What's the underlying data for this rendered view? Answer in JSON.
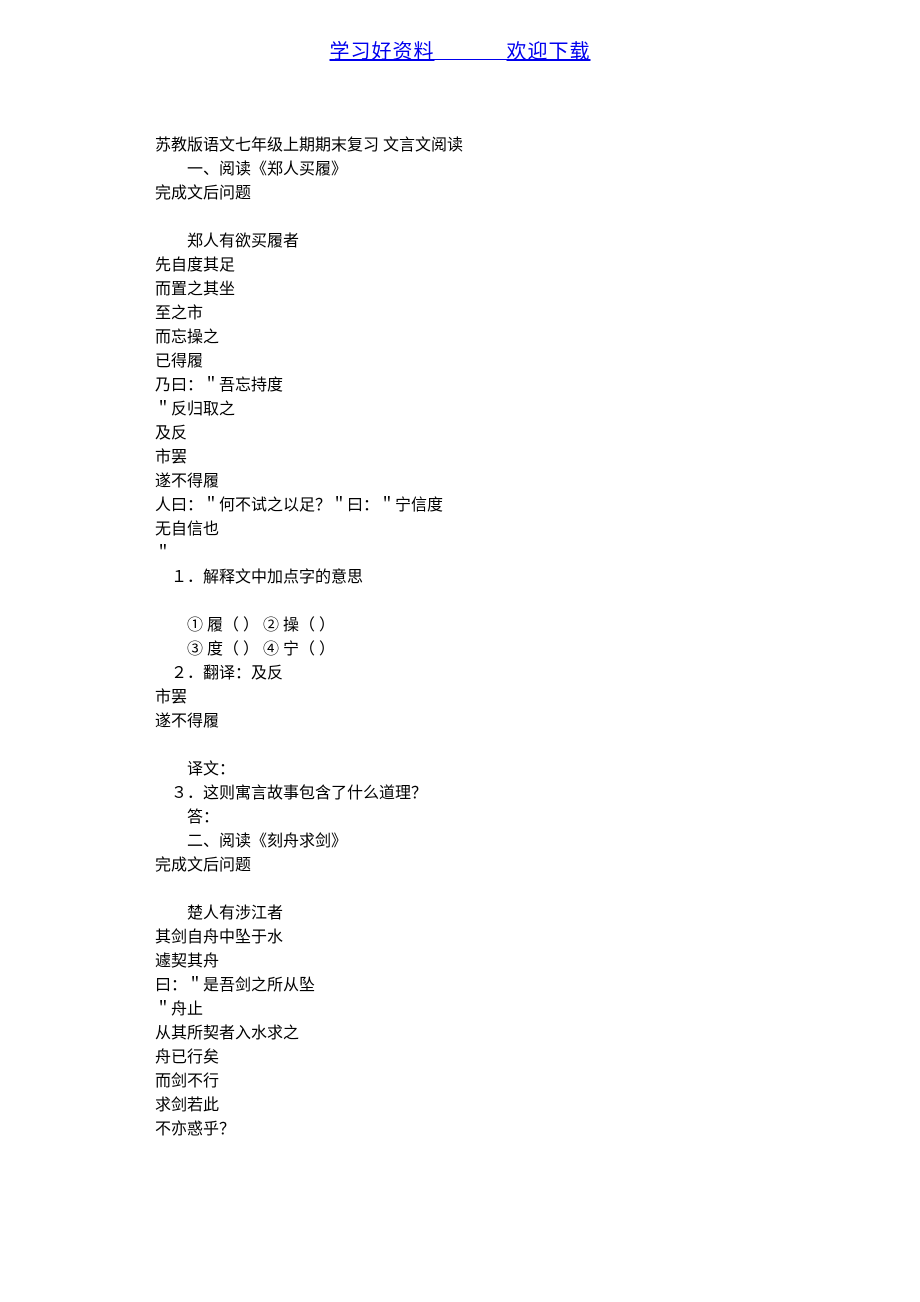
{
  "header": {
    "left": "学习好资料",
    "dashes": "            ",
    "right": "欢迎下载"
  },
  "body": {
    "title": "苏教版语文七年级上期期末复习  文言文阅读",
    "sec1_heading": "一、阅读《郑人买履》",
    "sec1_sub": "完成文后问题",
    "p1_l1": "郑人有欲买履者",
    "p1_l2": "先自度其足",
    "p1_l3": "而置之其坐",
    "p1_l4": "至之市",
    "p1_l5": "而忘操之",
    "p1_l6": "已得履",
    "p1_l7": "乃曰：＂吾忘持度",
    "p1_l8": "＂反归取之",
    "p1_l9": "及反",
    "p1_l10": "市罢",
    "p1_l11": "遂不得履",
    "p1_l12": "人曰：＂何不试之以足？＂曰：＂宁信度",
    "p1_l13": "无自信也",
    "p1_l14": "＂",
    "q1": "１．解释文中加点字的意思",
    "q1_a": "① 履（  ） ② 操（  ）",
    "q1_b": "③ 度（  ） ④ 宁（  ）",
    "q2": "２．翻译：及反",
    "q2_l2": "市罢",
    "q2_l3": "遂不得履",
    "q2_ans": "译文：",
    "q3": "３．这则寓言故事包含了什么道理？",
    "q3_ans": "答：",
    "sec2_heading": "二、阅读《刻舟求剑》",
    "sec2_sub": "完成文后问题",
    "p2_l1": "楚人有涉江者",
    "p2_l2": "其剑自舟中坠于水",
    "p2_l3": "遽契其舟",
    "p2_l4": "曰：＂是吾剑之所从坠",
    "p2_l5": "＂舟止",
    "p2_l6": "从其所契者入水求之",
    "p2_l7": "舟已行矣",
    "p2_l8": "而剑不行",
    "p2_l9": "求剑若此",
    "p2_l10": "不亦惑乎？"
  }
}
